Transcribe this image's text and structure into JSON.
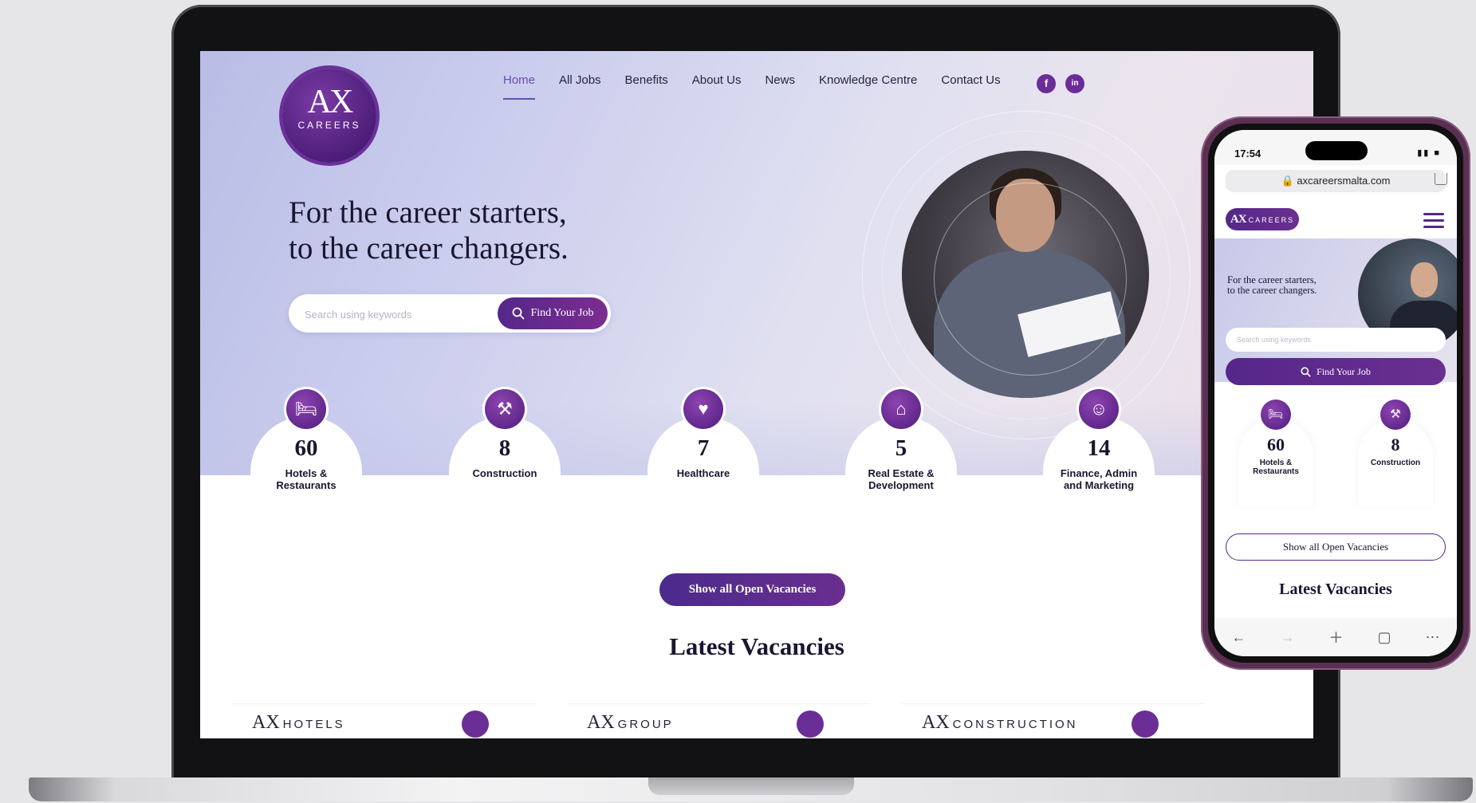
{
  "site": {
    "logo": {
      "mark": "AX",
      "sub": "CAREERS"
    },
    "nav": [
      {
        "label": "Home",
        "active": true
      },
      {
        "label": "All Jobs"
      },
      {
        "label": "Benefits"
      },
      {
        "label": "About Us"
      },
      {
        "label": "News"
      },
      {
        "label": "Knowledge Centre"
      },
      {
        "label": "Contact Us"
      }
    ],
    "social": {
      "facebook": "f",
      "linkedin": "in"
    },
    "hero": {
      "headline_line1": "For the career starters,",
      "headline_line2": "to the career changers.",
      "search_placeholder": "Search using keywords",
      "find_button": "Find Your Job"
    },
    "categories": [
      {
        "count": "60",
        "label": "Hotels & Restaurants",
        "icon": "bed-icon"
      },
      {
        "count": "8",
        "label": "Construction",
        "icon": "worker-icon"
      },
      {
        "count": "7",
        "label": "Healthcare",
        "icon": "heart-pulse-icon"
      },
      {
        "count": "5",
        "label": "Real Estate & Development",
        "icon": "house-icon"
      },
      {
        "count": "14",
        "label": "Finance, Admin and Marketing",
        "icon": "desk-person-icon"
      }
    ],
    "show_all": "Show all Open Vacancies",
    "latest_title": "Latest Vacancies",
    "vacancy_brands": [
      {
        "mark": "AX",
        "name": "HOTELS"
      },
      {
        "mark": "AX",
        "name": "GROUP"
      },
      {
        "mark": "AX",
        "name": "CONSTRUCTION"
      }
    ]
  },
  "phone": {
    "time": "17:54",
    "url": "axcareersmalta.com",
    "logo_mark": "AX",
    "logo_sub": "CAREERS",
    "headline_line1": "For the career starters,",
    "headline_line2": "to the career changers.",
    "search_placeholder": "Search using keywords",
    "find_button": "Find Your Job",
    "categories": [
      {
        "count": "60",
        "label": "Hotels & Restaurants"
      },
      {
        "count": "8",
        "label": "Construction"
      }
    ],
    "show_all": "Show all Open Vacancies",
    "latest_title": "Latest Vacancies"
  },
  "colors": {
    "brand_purple": "#55278a",
    "accent_purple": "#6a4fb0",
    "text_dark": "#1a1630"
  }
}
